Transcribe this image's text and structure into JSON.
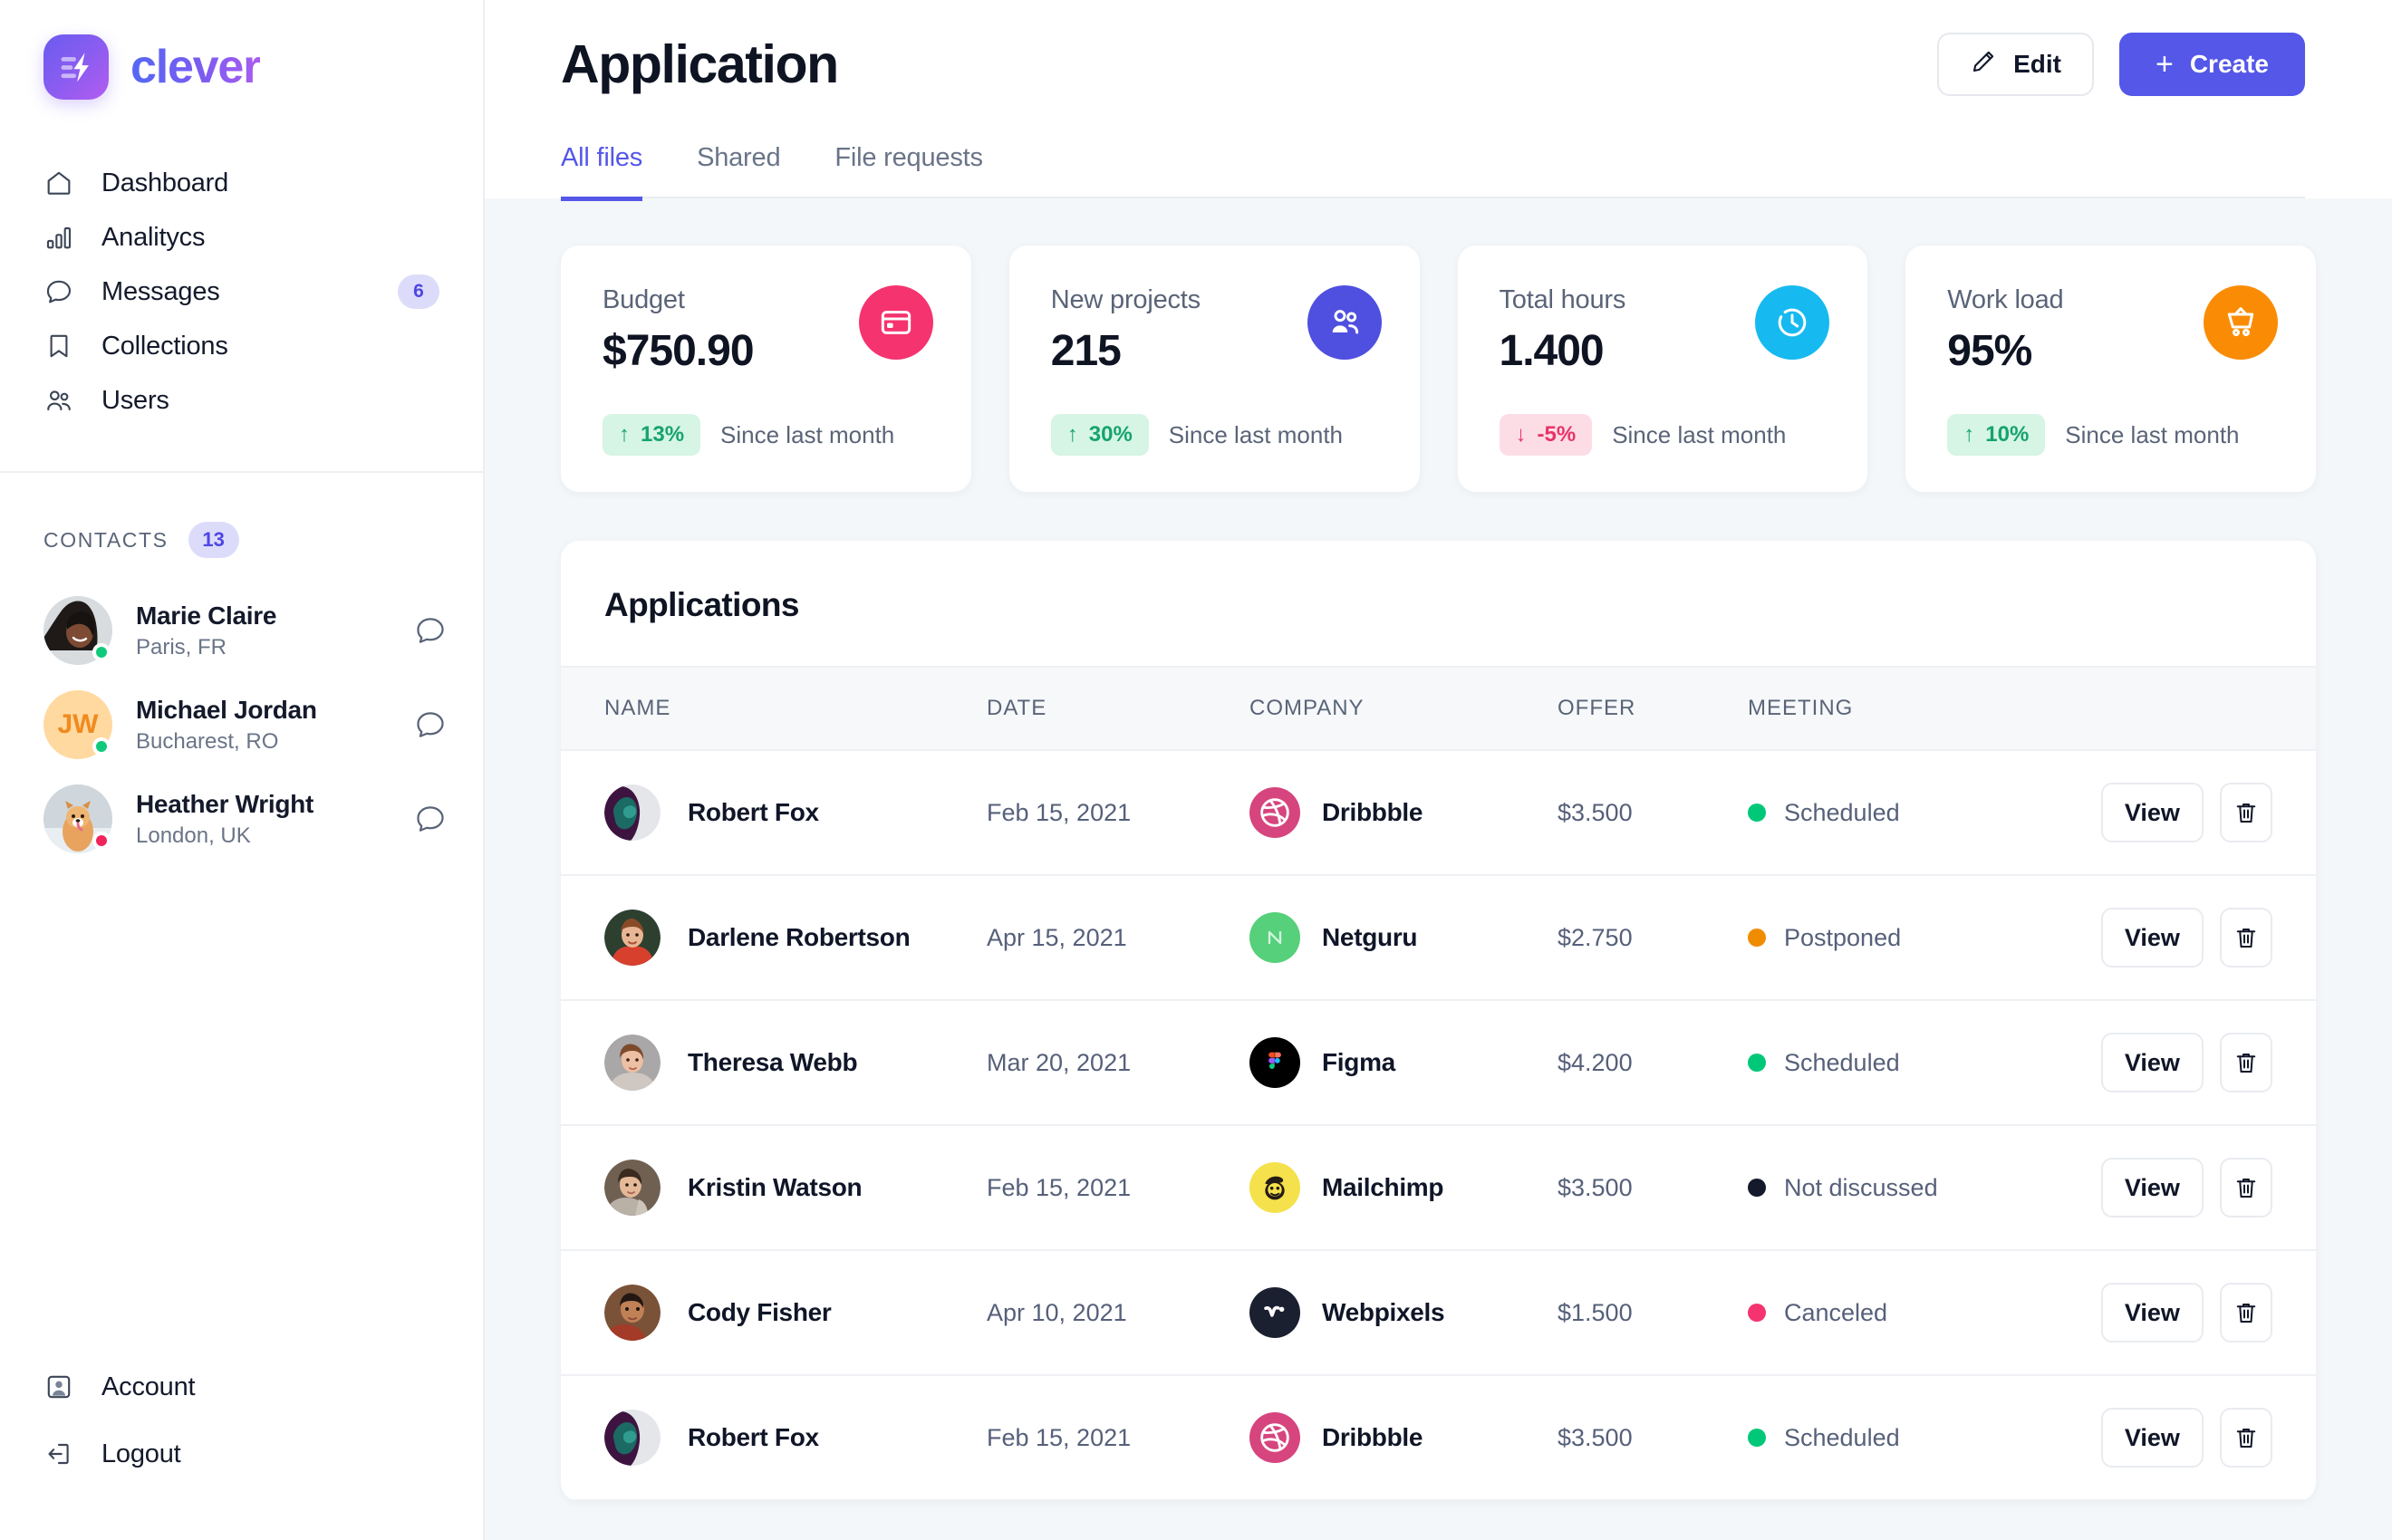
{
  "brand": {
    "name": "clever",
    "mark_icon": "lightning-bolt-icon"
  },
  "sidebar": {
    "nav": [
      {
        "label": "Dashboard",
        "icon": "home-icon",
        "badge": null
      },
      {
        "label": "Analitycs",
        "icon": "bar-chart-icon",
        "badge": null
      },
      {
        "label": "Messages",
        "icon": "chat-bubble-icon",
        "badge": "6"
      },
      {
        "label": "Collections",
        "icon": "bookmark-icon",
        "badge": null
      },
      {
        "label": "Users",
        "icon": "users-icon",
        "badge": null
      }
    ],
    "contacts": {
      "title": "CONTACTS",
      "count": "13",
      "items": [
        {
          "name": "Marie Claire",
          "location": "Paris, FR",
          "status_color": "#0fca7a",
          "avatar_kind": "photo",
          "avatar_initials": "",
          "avatar_bg": "#d9dde2",
          "chat_icon": "chat-bubble-icon"
        },
        {
          "name": "Michael Jordan",
          "location": "Bucharest, RO",
          "status_color": "#0fca7a",
          "avatar_kind": "initials",
          "avatar_initials": "JW",
          "avatar_bg": "#ffd9a0",
          "avatar_fg": "#f08a1e",
          "chat_icon": "chat-bubble-icon"
        },
        {
          "name": "Heather Wright",
          "location": "London, UK",
          "status_color": "#f0245c",
          "avatar_kind": "photo",
          "avatar_initials": "",
          "avatar_bg": "#cfd7dd",
          "chat_icon": "chat-bubble-icon"
        }
      ]
    },
    "bottom": [
      {
        "label": "Account",
        "icon": "account-badge-icon"
      },
      {
        "label": "Logout",
        "icon": "logout-arrow-icon"
      }
    ]
  },
  "header": {
    "title": "Application",
    "edit_label": "Edit",
    "edit_icon": "pencil-icon",
    "create_label": "Create",
    "create_plus": "+",
    "tabs": [
      {
        "label": "All files",
        "active": true
      },
      {
        "label": "Shared",
        "active": false
      },
      {
        "label": "File requests",
        "active": false
      }
    ]
  },
  "stats": [
    {
      "label": "Budget",
      "value": "$750.90",
      "delta": "13%",
      "delta_dir": "up",
      "delta_arrow": "↑",
      "since": "Since last month",
      "icon": "credit-card-icon",
      "icon_bg": "#f5336f"
    },
    {
      "label": "New projects",
      "value": "215",
      "delta": "30%",
      "delta_dir": "up",
      "delta_arrow": "↑",
      "since": "Since last month",
      "icon": "users-icon",
      "icon_bg": "#4f4fe0"
    },
    {
      "label": "Total hours",
      "value": "1.400",
      "delta": "-5%",
      "delta_dir": "down",
      "delta_arrow": "↓",
      "since": "Since last month",
      "icon": "clock-icon",
      "icon_bg": "#16baf0"
    },
    {
      "label": "Work load",
      "value": "95%",
      "delta": "10%",
      "delta_dir": "up",
      "delta_arrow": "↑",
      "since": "Since last month",
      "icon": "shopping-cart-icon",
      "icon_bg": "#fa8c05"
    }
  ],
  "table": {
    "title": "Applications",
    "columns": [
      "NAME",
      "DATE",
      "COMPANY",
      "OFFER",
      "MEETING"
    ],
    "view_label": "View",
    "delete_icon": "trash-icon",
    "rows": [
      {
        "name": "Robert Fox",
        "date": "Feb 15, 2021",
        "company": "Dribbble",
        "company_logo": "dribbble-icon",
        "company_bg": "#d6457e",
        "offer": "$3.500",
        "meeting": "Scheduled",
        "meeting_color": "#00c878",
        "avatar_bg": "#3b1f3f"
      },
      {
        "name": "Darlene Robertson",
        "date": "Apr 15, 2021",
        "company": "Netguru",
        "company_logo": "netguru-icon",
        "company_bg": "#56d07a",
        "offer": "$2.750",
        "meeting": "Postponed",
        "meeting_color": "#f08c00",
        "avatar_bg": "#8e4330"
      },
      {
        "name": "Theresa Webb",
        "date": "Mar 20, 2021",
        "company": "Figma",
        "company_logo": "figma-icon",
        "company_bg": "#000000",
        "offer": "$4.200",
        "meeting": "Scheduled",
        "meeting_color": "#00c878",
        "avatar_bg": "#9d9a9a"
      },
      {
        "name": "Kristin Watson",
        "date": "Feb 15, 2021",
        "company": "Mailchimp",
        "company_logo": "mailchimp-icon",
        "company_bg": "#f5e14b",
        "offer": "$3.500",
        "meeting": "Not discussed",
        "meeting_color": "#141a2b",
        "avatar_bg": "#6b5a4c"
      },
      {
        "name": "Cody Fisher",
        "date": "Apr 10, 2021",
        "company": "Webpixels",
        "company_logo": "webpixels-icon",
        "company_bg": "#1b2030",
        "offer": "$1.500",
        "meeting": "Canceled",
        "meeting_color": "#f5336f",
        "avatar_bg": "#8a5236"
      },
      {
        "name": "Robert Fox",
        "date": "Feb 15, 2021",
        "company": "Dribbble",
        "company_logo": "dribbble-icon",
        "company_bg": "#d6457e",
        "offer": "$3.500",
        "meeting": "Scheduled",
        "meeting_color": "#00c878",
        "avatar_bg": "#3b1f3f"
      }
    ]
  },
  "colors": {
    "accent": "#5457e8",
    "badge_bg": "#dcdcfa",
    "content_bg": "#f4f7f9"
  }
}
